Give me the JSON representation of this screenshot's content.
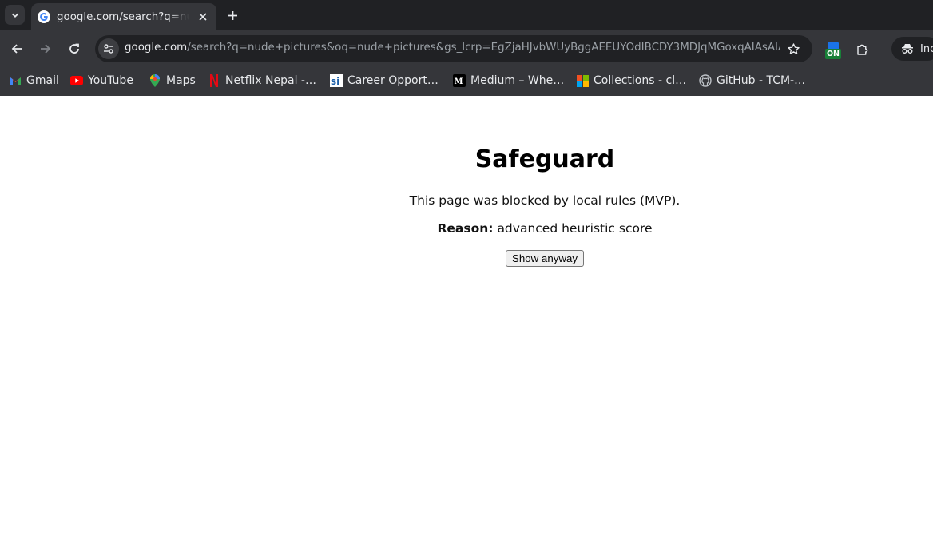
{
  "browser": {
    "tab": {
      "title": "google.com/search?q=nude+pictures",
      "favicon": "google-g-icon"
    },
    "address_bar": {
      "host": "google.com",
      "path": "/search?q=nude+pictures&oq=nude+pictures&gs_lcrp=EgZjaHJvbWUyBggAEEUYOdIBCDY3MDJqMGoxqAIAsAIA&so…"
    },
    "extension_badge": "ON",
    "profile_label": "Inc",
    "bookmarks": [
      {
        "label": "Gmail",
        "icon": "gmail-icon"
      },
      {
        "label": "YouTube",
        "icon": "youtube-icon"
      },
      {
        "label": "Maps",
        "icon": "maps-icon"
      },
      {
        "label": "Netflix Nepal -…",
        "icon": "netflix-icon"
      },
      {
        "label": "Career Opport…",
        "icon": "career-icon"
      },
      {
        "label": "Medium – Whe…",
        "icon": "medium-icon"
      },
      {
        "label": "Collections - cl…",
        "icon": "microsoft-icon"
      },
      {
        "label": "GitHub - TCM-…",
        "icon": "github-icon"
      }
    ]
  },
  "page": {
    "title": "Safeguard",
    "message": "This page was blocked by local rules (MVP).",
    "reason_label": "Reason:",
    "reason_value": "advanced heuristic score",
    "button_label": "Show anyway"
  },
  "colors": {
    "chrome_dark": "#202124",
    "chrome_toolbar": "#35363a",
    "chrome_text": "#e8eaed",
    "url_muted": "#9aa0a6",
    "page_bg": "#ffffff"
  }
}
